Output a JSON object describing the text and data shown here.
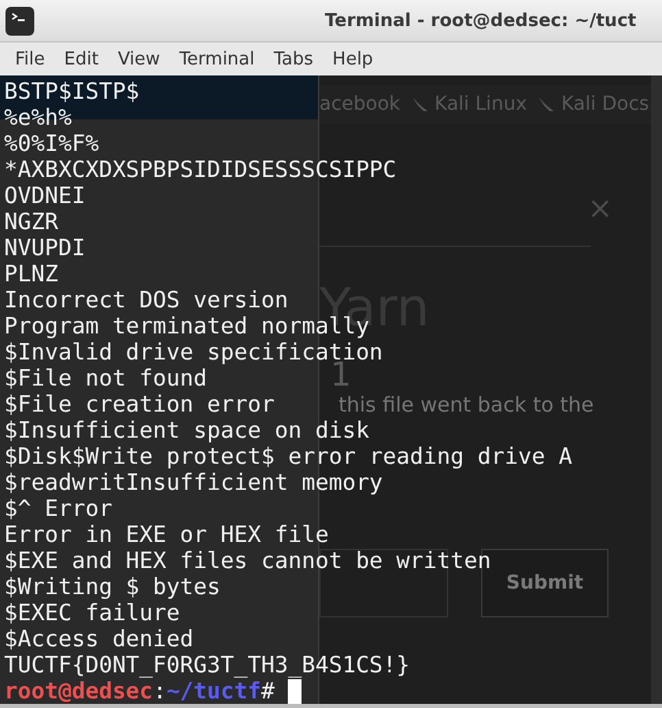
{
  "window": {
    "title": "Terminal - root@dedsec: ~/tuct"
  },
  "menu": [
    "File",
    "Edit",
    "View",
    "Terminal",
    "Tabs",
    "Help"
  ],
  "background_page": {
    "bookmarks": [
      "acebook",
      "Kali Linux",
      "Kali Docs"
    ],
    "close": "×",
    "heading": "Yarn",
    "number": "1",
    "text": "this file went back to the",
    "button": "Submit"
  },
  "terminal": {
    "lines": [
      "BSTP$ISTP$",
      "%e%h%",
      "%0%I%F%",
      "*AXBXCXDXSPBPSIDIDSESSSCSIPPC",
      "OVDNEI",
      "NGZR",
      "NVUPDI",
      "PLNZ",
      "Incorrect DOS version",
      "Program terminated normally",
      "$Invalid drive specification",
      "$File not found",
      "$File creation error",
      "$Insufficient space on disk",
      "$Disk$Write protect$ error reading drive A",
      "$readwritInsufficient memory",
      "$^ Error",
      "Error in EXE or HEX file",
      "$EXE and HEX files cannot be written",
      "$Writing $ bytes",
      "$EXEC failure",
      "$Access denied",
      "TUCTF{D0NT_F0RG3T_TH3_B4S1CS!}"
    ],
    "prompt": {
      "user_host": "root@dedsec",
      "separator": ":",
      "path": "~/tuctf",
      "symbol": "#"
    },
    "cursor_visible": true
  }
}
